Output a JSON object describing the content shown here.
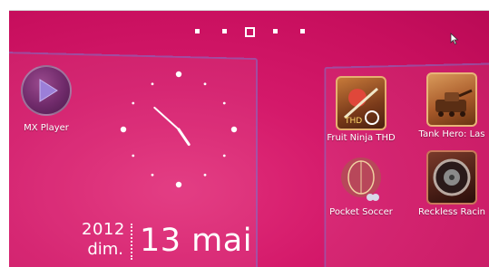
{
  "home": {
    "page_indicator": {
      "total": 5,
      "current": 3
    },
    "shortcuts": [
      {
        "label": "MX Player",
        "icon": "mx-player-icon"
      }
    ],
    "clock": {
      "hour": 4,
      "minute": 52
    },
    "date": {
      "year": "2012",
      "weekday": "dim.",
      "day_month": "13 mai"
    },
    "apps": [
      {
        "label": "Fruit Ninja THD",
        "icon": "fruit-ninja-icon"
      },
      {
        "label": "Tank Hero: Las",
        "icon": "tank-hero-icon"
      },
      {
        "label": "Pocket Soccer",
        "icon": "pocket-soccer-icon"
      },
      {
        "label": "Reckless Racin",
        "icon": "reckless-racing-icon"
      }
    ]
  },
  "colors": {
    "background": "#cf1665",
    "panel_border": "#8a80cc",
    "text": "#ffffff"
  }
}
